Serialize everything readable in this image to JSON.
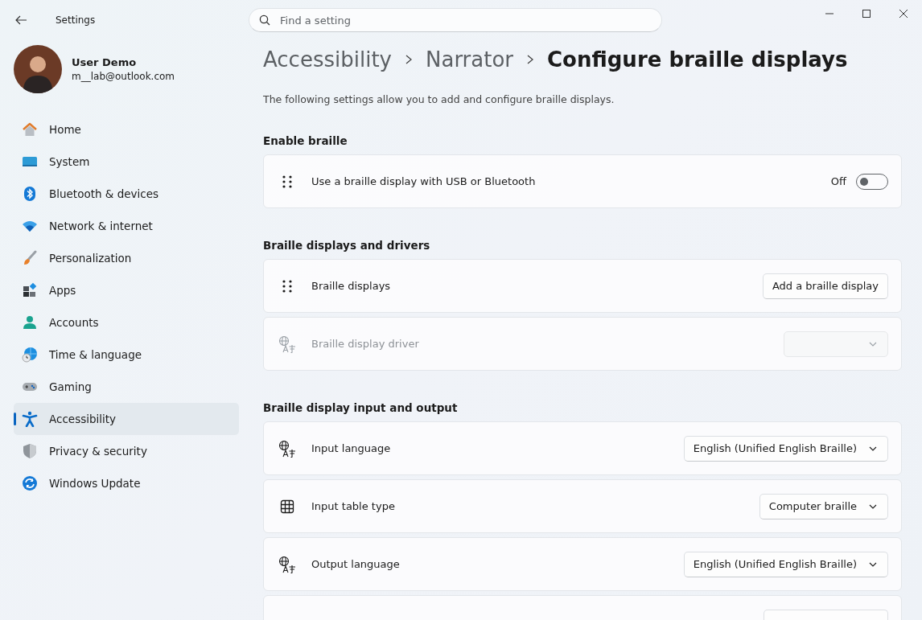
{
  "window": {
    "title": "Settings"
  },
  "search": {
    "placeholder": "Find a setting"
  },
  "user": {
    "name": "User Demo",
    "email": "m__lab@outlook.com"
  },
  "nav": [
    {
      "label": "Home",
      "selected": false
    },
    {
      "label": "System",
      "selected": false
    },
    {
      "label": "Bluetooth & devices",
      "selected": false
    },
    {
      "label": "Network & internet",
      "selected": false
    },
    {
      "label": "Personalization",
      "selected": false
    },
    {
      "label": "Apps",
      "selected": false
    },
    {
      "label": "Accounts",
      "selected": false
    },
    {
      "label": "Time & language",
      "selected": false
    },
    {
      "label": "Gaming",
      "selected": false
    },
    {
      "label": "Accessibility",
      "selected": true
    },
    {
      "label": "Privacy & security",
      "selected": false
    },
    {
      "label": "Windows Update",
      "selected": false
    }
  ],
  "breadcrumb": [
    "Accessibility",
    "Narrator",
    "Configure braille displays"
  ],
  "description": "The following settings allow you to add and configure braille displays.",
  "sections": [
    {
      "title": "Enable braille",
      "rows": [
        {
          "kind": "toggle",
          "label": "Use a braille display with USB or Bluetooth",
          "state_label": "Off",
          "on": false
        }
      ]
    },
    {
      "title": "Braille displays and drivers",
      "rows": [
        {
          "kind": "button",
          "label": "Braille displays",
          "button": "Add a braille display"
        },
        {
          "kind": "dropdown",
          "label": "Braille display driver",
          "disabled": true
        }
      ]
    },
    {
      "title": "Braille display input and output",
      "rows": [
        {
          "kind": "dropdown",
          "label": "Input language",
          "value": "English (Unified English Braille)",
          "disabled": false
        },
        {
          "kind": "dropdown",
          "label": "Input table type",
          "value": "Computer braille",
          "disabled": false
        },
        {
          "kind": "dropdown",
          "label": "Output language",
          "value": "English (Unified English Braille)",
          "disabled": false
        },
        {
          "kind": "partial"
        }
      ]
    }
  ]
}
